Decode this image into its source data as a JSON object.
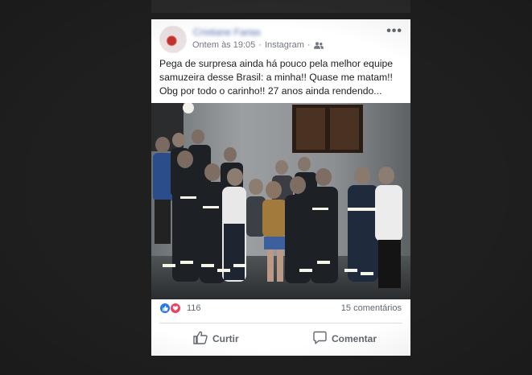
{
  "post": {
    "author_name": "Cristiane Farias",
    "timestamp": "Ontem às 19:05",
    "separator": "·",
    "source": "Instagram",
    "privacy_icon": "friends-icon",
    "more_label": "•••",
    "text_lines": [
      "Pega de surpresa ainda há pouco pela melhor equipe",
      "samuzeira desse Brasil: a minha!! Quase me matam!!",
      "Obg por todo o carinho!! 27 anos ainda rendendo..."
    ],
    "reactions_count": "116",
    "reaction_icons": [
      "like-reaction-icon",
      "love-reaction-icon"
    ],
    "comments_count": "15 comentários",
    "like_label": "Curtir",
    "comment_label": "Comentar"
  },
  "colors": {
    "background": "#1f1f1f",
    "card": "#ffffff",
    "link": "#4b6aa8",
    "meta": "#737880",
    "like_blue": "#2078f4",
    "love_red": "#f33e58"
  }
}
